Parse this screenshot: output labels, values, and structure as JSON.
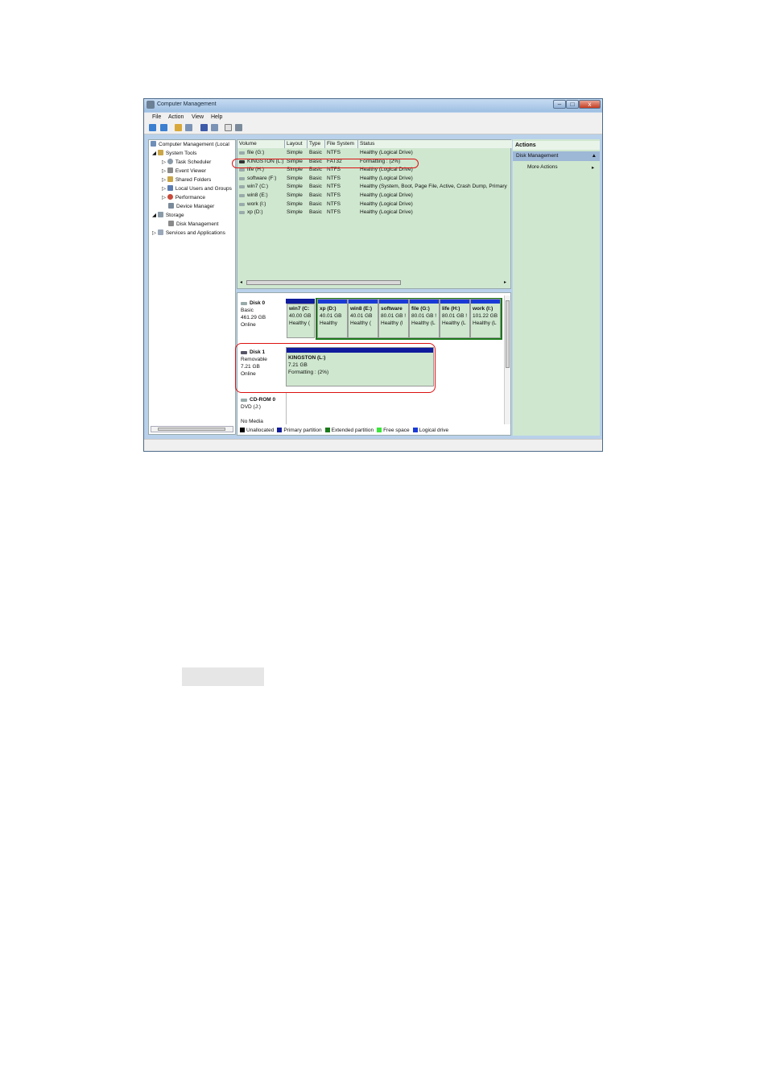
{
  "window": {
    "title": "Computer Management",
    "controls": {
      "minimize": "–",
      "maximize": "□",
      "close": "x"
    }
  },
  "menu": [
    "File",
    "Action",
    "View",
    "Help"
  ],
  "tree": {
    "root": "Computer Management (Local",
    "items": [
      {
        "label": "System Tools",
        "level": 1
      },
      {
        "label": "Task Scheduler",
        "level": 2
      },
      {
        "label": "Event Viewer",
        "level": 2
      },
      {
        "label": "Shared Folders",
        "level": 2
      },
      {
        "label": "Local Users and Groups",
        "level": 2
      },
      {
        "label": "Performance",
        "level": 2
      },
      {
        "label": "Device Manager",
        "level": 2
      },
      {
        "label": "Storage",
        "level": 1
      },
      {
        "label": "Disk Management",
        "level": 2
      },
      {
        "label": "Services and Applications",
        "level": 1
      }
    ]
  },
  "volumes": {
    "headers": [
      "Volume",
      "Layout",
      "Type",
      "File System",
      "Status"
    ],
    "rows": [
      [
        "file (G:)",
        "Simple",
        "Basic",
        "NTFS",
        "Healthy (Logical Drive)"
      ],
      [
        "KINGSTON (L:)",
        "Simple",
        "Basic",
        "FAT32",
        "Formatting : (2%)"
      ],
      [
        "life (H:)",
        "Simple",
        "Basic",
        "NTFS",
        "Healthy (Logical Drive)"
      ],
      [
        "software (F:)",
        "Simple",
        "Basic",
        "NTFS",
        "Healthy (Logical Drive)"
      ],
      [
        "win7 (C:)",
        "Simple",
        "Basic",
        "NTFS",
        "Healthy (System, Boot, Page File, Active, Crash Dump, Primary"
      ],
      [
        "win8 (E:)",
        "Simple",
        "Basic",
        "NTFS",
        "Healthy (Logical Drive)"
      ],
      [
        "work (I:)",
        "Simple",
        "Basic",
        "NTFS",
        "Healthy (Logical Drive)"
      ],
      [
        "xp (D:)",
        "Simple",
        "Basic",
        "NTFS",
        "Healthy (Logical Drive)"
      ]
    ]
  },
  "disks": {
    "disk0": {
      "name": "Disk 0",
      "type": "Basic",
      "size": "461.29 GB",
      "state": "Online",
      "partitions": [
        {
          "name": "win7 (C:",
          "size": "40.00 GB",
          "status": "Healthy ("
        },
        {
          "name": "xp (D:)",
          "size": "40.01 GB",
          "status": "Healthy"
        },
        {
          "name": "win8 (E:)",
          "size": "40.01 GB",
          "status": "Healthy ("
        },
        {
          "name": "software",
          "size": "80.01 GB !",
          "status": "Healthy (l"
        },
        {
          "name": "file (G:)",
          "size": "80.01 GB !",
          "status": "Healthy (L"
        },
        {
          "name": "life (H:)",
          "size": "80.01 GB !",
          "status": "Healthy (L"
        },
        {
          "name": "work (I:)",
          "size": "101.22 GB",
          "status": "Healthy (L"
        }
      ]
    },
    "disk1": {
      "name": "Disk 1",
      "type": "Removable",
      "size": "7.21 GB",
      "state": "Online",
      "partition": {
        "name": "KINGSTON (L:)",
        "size": "7.21 GB",
        "status": "Formatting : (2%)"
      }
    },
    "cdrom": {
      "name": "CD-ROM 0",
      "drive": "DVD (J:)",
      "media": "No Media"
    }
  },
  "legend": [
    {
      "label": "Unallocated",
      "color": "#000000"
    },
    {
      "label": "Primary partition",
      "color": "#0f1c9c"
    },
    {
      "label": "Extended partition",
      "color": "#1a7a1a"
    },
    {
      "label": "Free space",
      "color": "#39e639"
    },
    {
      "label": "Logical drive",
      "color": "#1a3ad6"
    }
  ],
  "actions": {
    "title": "Actions",
    "section": "Disk Management",
    "more": "More Actions"
  }
}
